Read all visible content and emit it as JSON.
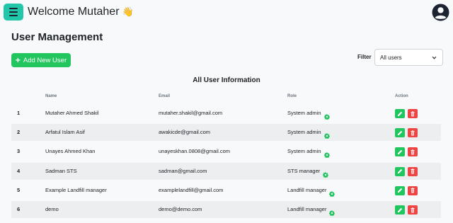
{
  "header": {
    "welcome": "Welcome Mutaher",
    "wave_emoji": "👋"
  },
  "page": {
    "title": "User Management",
    "add_button_label": "Add New User",
    "filter_label": "Filter",
    "filter_selected": "All users"
  },
  "table": {
    "title": "All User Information",
    "columns": {
      "name": "Name",
      "email": "Email",
      "role": "Role",
      "action": "Action"
    },
    "rows": [
      {
        "index": "1",
        "name": "Mutaher Ahmed Shakil",
        "email": "mutaher.shakil@gmail.com",
        "role": "System admin"
      },
      {
        "index": "2",
        "name": "Arfatul Islam Asif",
        "email": "awakicde@gmail.com",
        "role": "System admin"
      },
      {
        "index": "3",
        "name": "Unayes Ahmed Khan",
        "email": "unayeskhan.0808@gmail.com",
        "role": "System admin"
      },
      {
        "index": "4",
        "name": "Sadman STS",
        "email": "sadman@gmail.com",
        "role": "STS manager"
      },
      {
        "index": "5",
        "name": "Example Landfill manager",
        "email": "examplelandfill@gmail.com",
        "role": "Landfill manager"
      },
      {
        "index": "6",
        "name": "demo",
        "email": "demo@demo.com",
        "role": "Landfill manager"
      }
    ]
  },
  "icons": {
    "menu": "hamburger-icon",
    "profile": "user-circle-icon",
    "add": "plus-icon",
    "role_settings": "gear-icon",
    "edit": "pencil-icon",
    "delete": "trash-icon"
  },
  "colors": {
    "menu_button": "#22c7a9",
    "primary_green": "#22c55e",
    "danger_red": "#ef4444",
    "gear_green": "#22c55e"
  }
}
